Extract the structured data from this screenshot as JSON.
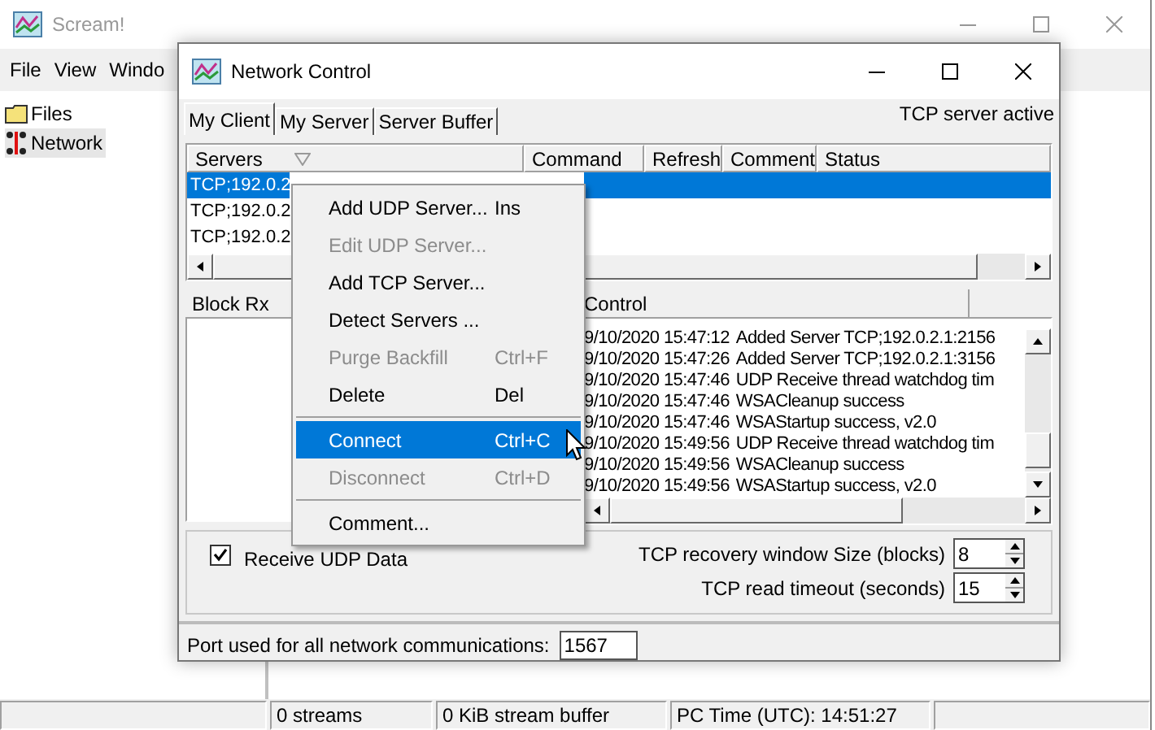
{
  "main_window": {
    "title": "Scream!",
    "menu": [
      {
        "label": "File"
      },
      {
        "label": "View"
      },
      {
        "label": "Windo"
      }
    ],
    "tree": [
      {
        "label": "Files",
        "selected": false
      },
      {
        "label": "Network",
        "selected": true
      }
    ],
    "status_bar": [
      "0 streams",
      "0 KiB stream buffer",
      "PC Time (UTC):  14:51:27"
    ]
  },
  "dialog": {
    "title": "Network Control",
    "tabs": [
      {
        "label": "My Client",
        "selected": true
      },
      {
        "label": "My Server",
        "selected": false
      },
      {
        "label": "Server Buffer",
        "selected": false
      }
    ],
    "server_status": "TCP server active",
    "servers": {
      "columns": [
        "Servers",
        "Command",
        "Refresh",
        "Comment",
        "Status"
      ],
      "rows": [
        {
          "address": "TCP;192.0.2",
          "selected": true
        },
        {
          "address": "TCP;192.0.2",
          "selected": false
        },
        {
          "address": "TCP;192.0.2",
          "selected": false
        }
      ]
    },
    "block_rx": {
      "header": "Block Rx"
    },
    "log": {
      "header": "Control",
      "lines": [
        {
          "time": "9/10/2020 15:47:12",
          "message": "Added Server TCP;192.0.2.1:2156"
        },
        {
          "time": "9/10/2020 15:47:26",
          "message": "Added Server TCP;192.0.2.1:3156"
        },
        {
          "time": "9/10/2020 15:47:46",
          "message": "UDP Receive thread watchdog tim"
        },
        {
          "time": "9/10/2020 15:47:46",
          "message": "WSACleanup success"
        },
        {
          "time": "9/10/2020 15:47:46",
          "message": "WSAStartup success, v2.0"
        },
        {
          "time": "9/10/2020 15:49:56",
          "message": "UDP Receive thread watchdog tim"
        },
        {
          "time": "9/10/2020 15:49:56",
          "message": "WSACleanup success"
        },
        {
          "time": "9/10/2020 15:49:56",
          "message": "WSAStartup success, v2.0"
        }
      ]
    },
    "receive_udp": {
      "label": "Receive UDP Data",
      "checked": true
    },
    "spinners": [
      {
        "label": "TCP recovery window Size (blocks)",
        "value": "8"
      },
      {
        "label": "TCP read timeout (seconds)",
        "value": "15"
      }
    ],
    "port": {
      "label": "Port used for all network communications:",
      "value": "1567"
    }
  },
  "context_menu": [
    {
      "kind": "item",
      "label": "Add UDP Server...",
      "shortcut": "Ins",
      "disabled": false,
      "selected": false
    },
    {
      "kind": "item",
      "label": "Edit UDP Server...",
      "disabled": true,
      "selected": false
    },
    {
      "kind": "item",
      "label": "Add TCP Server...",
      "disabled": false,
      "selected": false
    },
    {
      "kind": "item",
      "label": "Detect Servers ...",
      "disabled": false,
      "selected": false
    },
    {
      "kind": "item",
      "label": "Purge Backfill",
      "shortcut": "Ctrl+F",
      "disabled": true,
      "selected": false
    },
    {
      "kind": "item",
      "label": "Delete",
      "shortcut": "Del",
      "disabled": false,
      "selected": false
    },
    {
      "kind": "separator"
    },
    {
      "kind": "item",
      "label": "Connect",
      "shortcut": "Ctrl+C",
      "disabled": false,
      "selected": true
    },
    {
      "kind": "item",
      "label": "Disconnect",
      "shortcut": "Ctrl+D",
      "disabled": true,
      "selected": false
    },
    {
      "kind": "separator"
    },
    {
      "kind": "item",
      "label": "Comment...",
      "disabled": false,
      "selected": false
    }
  ]
}
